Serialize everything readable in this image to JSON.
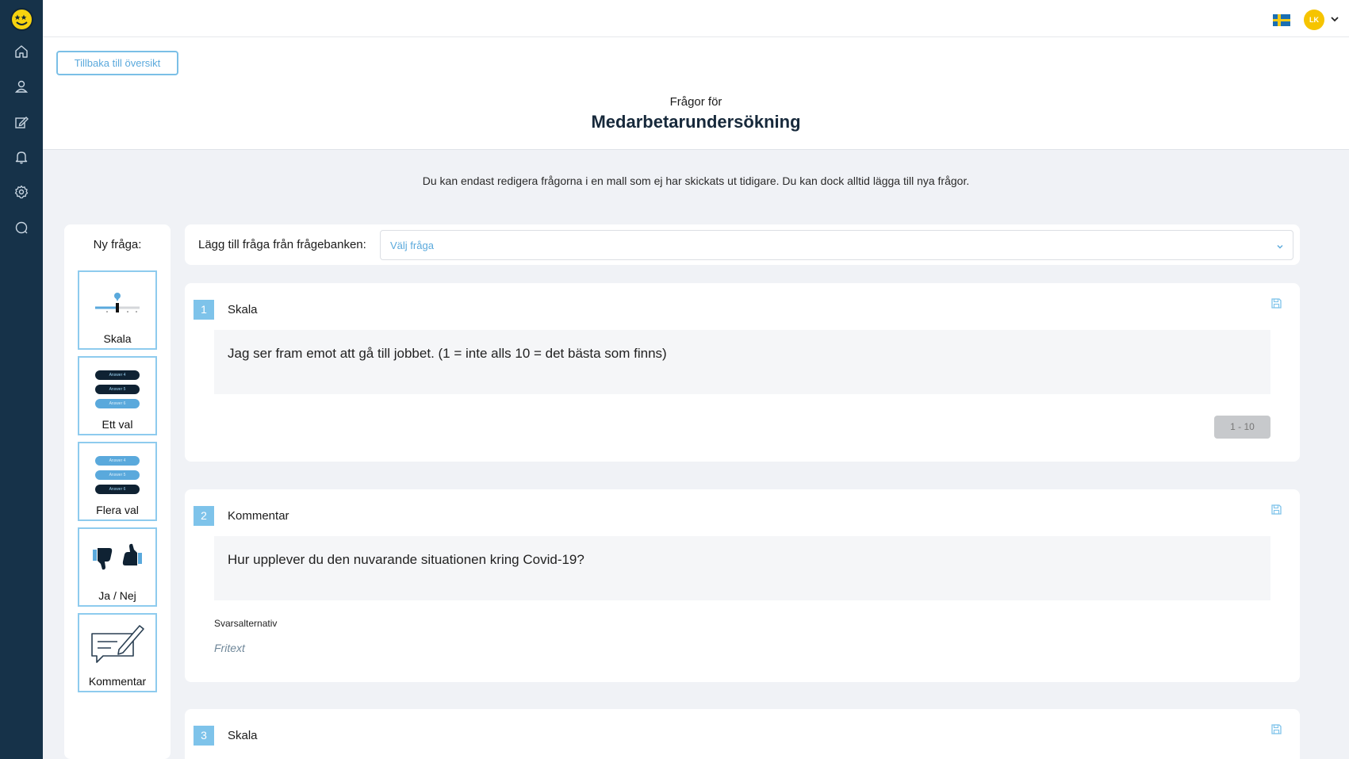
{
  "topbar": {
    "avatar_initials": "LK"
  },
  "header": {
    "back_label": "Tillbaka till översikt",
    "subtitle": "Frågor för",
    "title": "Medarbetarundersökning"
  },
  "notice": "Du kan endast redigera frågorna i en mall som ej har skickats ut tidigare. Du kan dock alltid lägga till nya frågor.",
  "new_question": {
    "title": "Ny fråga:",
    "types": [
      {
        "label": "Skala"
      },
      {
        "label": "Ett val",
        "pills": [
          "Answer 4",
          "Answer 5",
          "Answer 6"
        ]
      },
      {
        "label": "Flera val",
        "pills": [
          "Answer 4",
          "Answer 5",
          "Answer 6"
        ]
      },
      {
        "label": "Ja / Nej"
      },
      {
        "label": "Kommentar"
      }
    ]
  },
  "question_bank": {
    "label": "Lägg till fråga från frågebanken:",
    "select_placeholder": "Välj fråga"
  },
  "questions": [
    {
      "number": "1",
      "type": "Skala",
      "text": "Jag ser fram emot att gå till jobbet. (1 = inte alls 10 = det bästa som finns)",
      "range": "1 - 10"
    },
    {
      "number": "2",
      "type": "Kommentar",
      "text": "Hur upplever du den nuvarande situationen kring Covid-19?",
      "answer_label": "Svarsalternativ",
      "answer_value": "Fritext"
    },
    {
      "number": "3",
      "type": "Skala"
    }
  ],
  "colors": {
    "sidebar": "#163249",
    "accent": "#7ec3ea",
    "avatar": "#f6c400",
    "logo": "#f6d30f"
  },
  "icons": {
    "nav": [
      "home-icon",
      "user-icon",
      "edit-icon",
      "bell-icon",
      "gear-icon",
      "search-icon"
    ],
    "topbar": [
      "swedish-flag-icon",
      "chevron-down-icon"
    ],
    "card": [
      "save-icon"
    ]
  }
}
